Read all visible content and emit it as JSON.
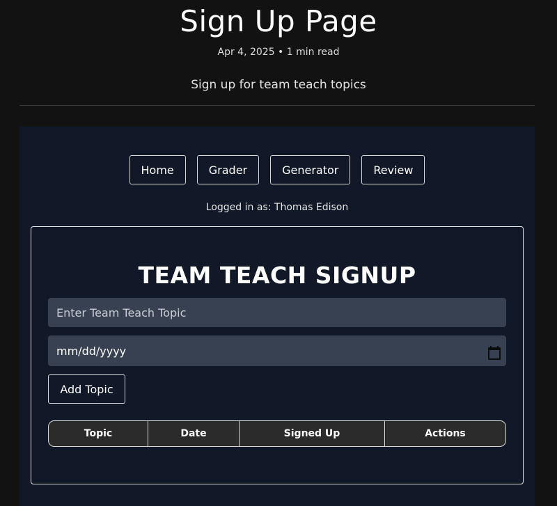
{
  "page": {
    "title": "Sign Up Page",
    "meta": "Apr 4, 2025 • 1 min read",
    "subtitle": "Sign up for team teach topics"
  },
  "nav": {
    "items": [
      {
        "label": "Home"
      },
      {
        "label": "Grader"
      },
      {
        "label": "Generator"
      },
      {
        "label": "Review"
      }
    ]
  },
  "user": {
    "logged_in_text": "Logged in as: Thomas Edison"
  },
  "signup": {
    "heading": "TEAM TEACH SIGNUP",
    "topic_placeholder": "Enter Team Teach Topic",
    "date_placeholder": "mm/dd/yyyy",
    "add_button": "Add Topic"
  },
  "table": {
    "columns": [
      "Topic",
      "Date",
      "Signed Up",
      "Actions"
    ],
    "rows": []
  },
  "icons": {
    "date_picker": "calendar-icon"
  },
  "colors": {
    "page_bg": "#121212",
    "panel_bg": "#111827",
    "input_bg": "#374151",
    "table_header_bg": "#2b2b2b"
  }
}
